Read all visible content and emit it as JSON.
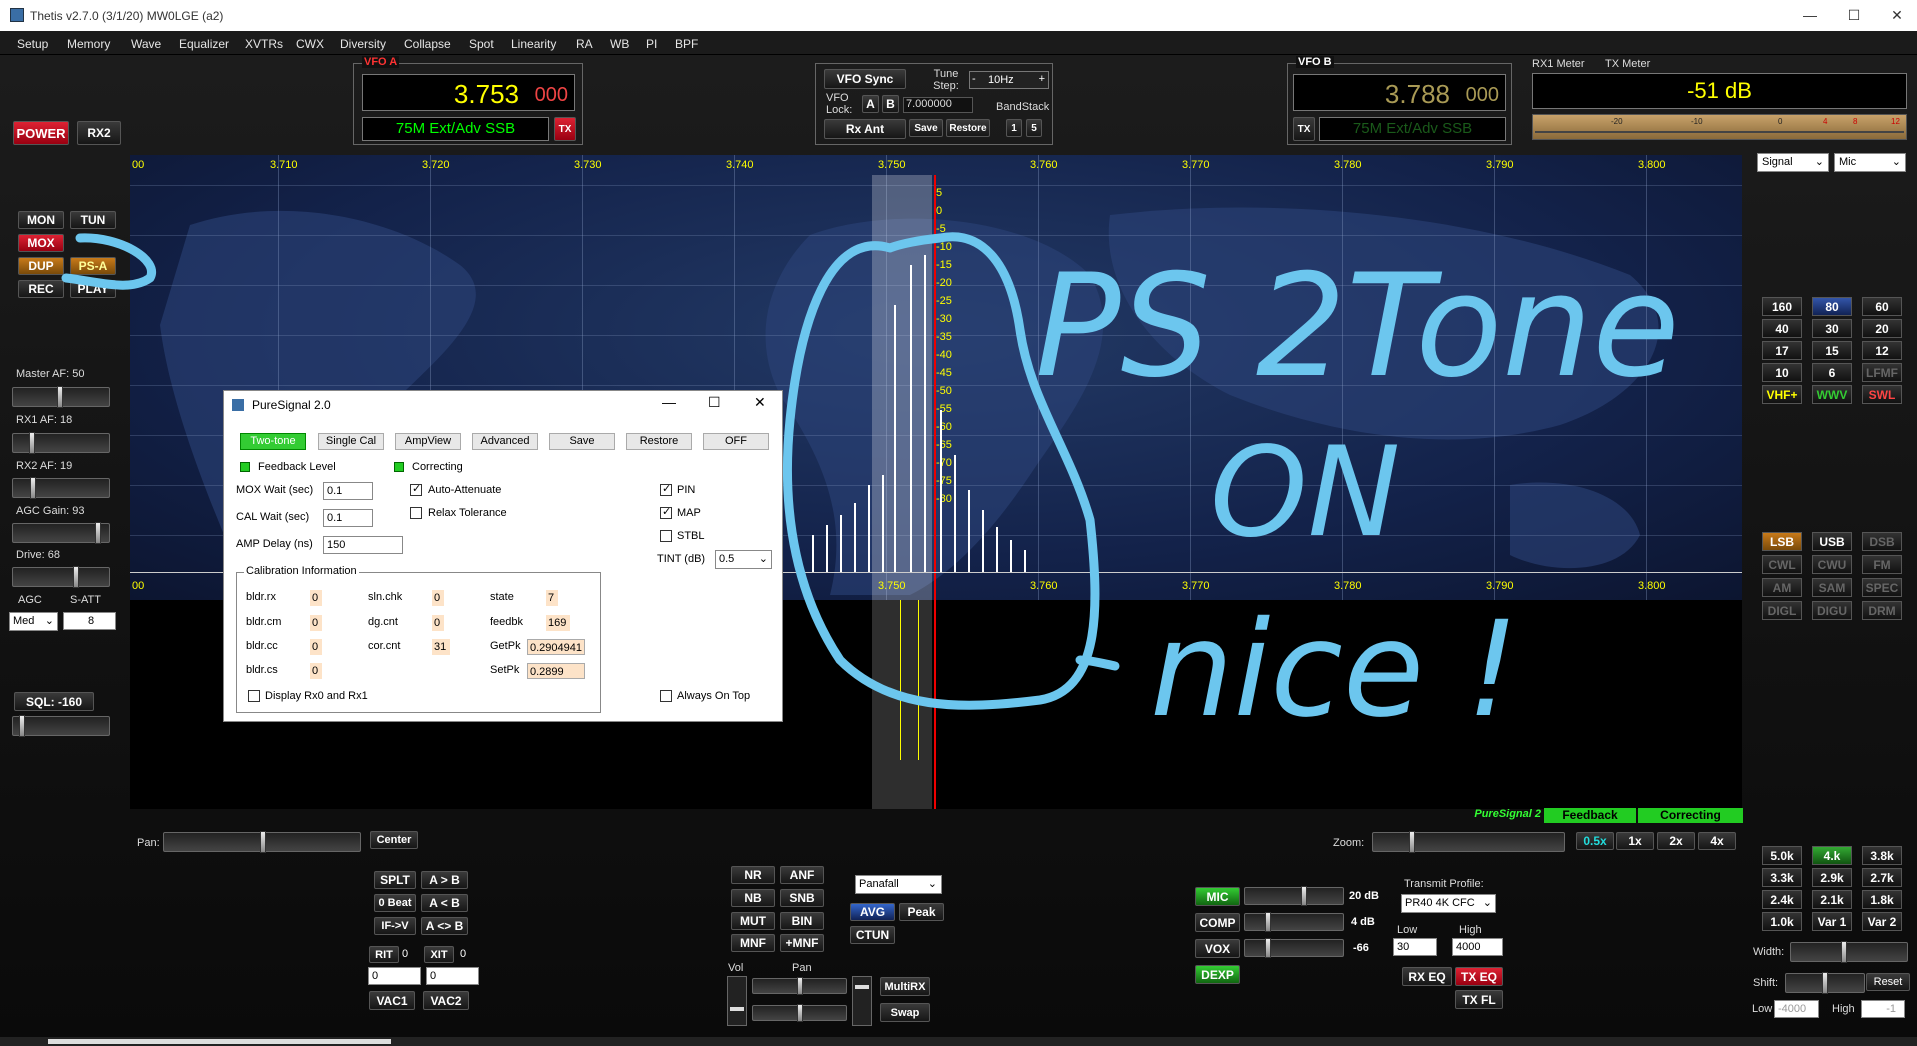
{
  "window": {
    "title": "Thetis v2.7.0 (3/1/20) MW0LGE (a2)",
    "min": "—",
    "max": "☐",
    "close": "✕"
  },
  "menu": [
    "Setup",
    "Memory",
    "Wave",
    "Equalizer",
    "XVTRs",
    "CWX",
    "Diversity",
    "Collapse",
    "Spot",
    "Linearity",
    "RA",
    "WB",
    "PI",
    "BPF"
  ],
  "left": {
    "power": "POWER",
    "rx2": "RX2",
    "mon": "MON",
    "tun": "TUN",
    "mox": "MOX",
    "dup": "DUP",
    "psa": "PS-A",
    "rec": "REC",
    "play": "PLAY",
    "master_af": "Master AF:  50",
    "rx1_af": "RX1 AF:  18",
    "rx2_af": "RX2 AF:  19",
    "agc_gain": "AGC Gain:  93",
    "drive": "Drive:  68",
    "agc": "AGC",
    "satt": "S-ATT",
    "agc_mode": "Med",
    "satt_val": "8",
    "sql": "SQL:  -160"
  },
  "levels": {
    "master_af": 0.5,
    "rx1_af": 0.18,
    "rx2_af": 0.19,
    "agc_gain": 0.93,
    "drive": 0.68
  },
  "vfoa": {
    "label": "VFO A",
    "freq": "3.753",
    "sub": "000",
    "mode": "75M Ext/Adv SSB",
    "tx": "TX"
  },
  "vfob": {
    "label": "VFO B",
    "freq": "3.788",
    "sub": "000",
    "mode": "75M Ext/Adv SSB",
    "tx": "TX"
  },
  "center": {
    "vfo_sync": "VFO Sync",
    "tune_step": "Tune Step:",
    "step_val": "10Hz",
    "vfo_lock": "VFO Lock:",
    "a": "A",
    "b": "B",
    "freq": "7.000000",
    "bandstack": "BandStack",
    "rx_ant": "Rx Ant",
    "save": "Save",
    "restore": "Restore",
    "b1": "1",
    "b5": "5"
  },
  "meter": {
    "rx1": "RX1 Meter",
    "tx": "TX Meter",
    "reading": "-51 dB",
    "scale": [
      "-20",
      "-10",
      "0",
      "4",
      "8",
      "12"
    ],
    "sel1": "Signal",
    "sel2": "Mic"
  },
  "panadapter": {
    "top_freqs": [
      "00",
      "3.710",
      "3.720",
      "3.730",
      "3.740",
      "3.750",
      "3.760",
      "3.770",
      "3.780",
      "3.790",
      "3.800"
    ],
    "bottom_freqs": [
      "00",
      "3.750",
      "3.760",
      "3.770",
      "3.780",
      "3.790",
      "3.800"
    ],
    "db": [
      "5",
      "0",
      "-5",
      "-10",
      "-15",
      "-20",
      "-25",
      "-30",
      "-35",
      "-40",
      "-45",
      "-50",
      "-55",
      "-60",
      "-65",
      "-70",
      "-75",
      "-80"
    ],
    "status_ps": "PureSignal 2",
    "status_fb": "Feedback",
    "status_corr": "Correcting"
  },
  "ps": {
    "title": "PureSignal 2.0",
    "two_tone": "Two-tone",
    "single_cal": "Single Cal",
    "ampview": "AmpView",
    "advanced": "Advanced",
    "save": "Save",
    "restore": "Restore",
    "off": "OFF",
    "feedback_level": "Feedback Level",
    "correcting": "Correcting",
    "mox_wait": "MOX Wait (sec)",
    "mox_wait_val": "0.1",
    "cal_wait": "CAL Wait (sec)",
    "cal_wait_val": "0.1",
    "amp_delay": "AMP Delay (ns)",
    "amp_delay_val": "150",
    "auto_att": "Auto-Attenuate",
    "relax": "Relax Tolerance",
    "pin": "PIN",
    "map": "MAP",
    "stbl": "STBL",
    "tint": "TINT (dB)",
    "tint_val": "0.5",
    "calinfo": "Calibration Information",
    "bldr_rx": "bldr.rx",
    "bldr_rx_v": "0",
    "bldr_cm": "bldr.cm",
    "bldr_cm_v": "0",
    "bldr_cc": "bldr.cc",
    "bldr_cc_v": "0",
    "bldr_cs": "bldr.cs",
    "bldr_cs_v": "0",
    "sln_chk": "sln.chk",
    "sln_chk_v": "0",
    "dg_cnt": "dg.cnt",
    "dg_cnt_v": "0",
    "cor_cnt": "cor.cnt",
    "cor_cnt_v": "31",
    "state": "state",
    "state_v": "7",
    "feedbk": "feedbk",
    "feedbk_v": "169",
    "getpk": "GetPk",
    "getpk_v": "0.2904941",
    "setpk": "SetPk",
    "setpk_v": "0.2899",
    "display_rx": "Display Rx0 and Rx1",
    "always_top": "Always On Top"
  },
  "bands": [
    "160",
    "80",
    "60",
    "40",
    "30",
    "20",
    "17",
    "15",
    "12",
    "10",
    "6",
    "LFMF",
    "VHF+",
    "WWV",
    "SWL"
  ],
  "modes": [
    "LSB",
    "USB",
    "DSB",
    "CWL",
    "CWU",
    "FM",
    "AM",
    "SAM",
    "SPEC",
    "DIGL",
    "DIGU",
    "DRM"
  ],
  "filters": [
    "5.0k",
    "4.k",
    "3.8k",
    "3.3k",
    "2.9k",
    "2.7k",
    "2.4k",
    "2.1k",
    "1.8k",
    "1.0k",
    "Var 1",
    "Var 2"
  ],
  "filter_ctrl": {
    "width": "Width:",
    "shift": "Shift:",
    "reset": "Reset",
    "low": "Low",
    "low_v": "-4000",
    "high": "High",
    "high_v": "-1"
  },
  "bottom": {
    "pan": "Pan:",
    "center": "Center",
    "zoom": "Zoom:",
    "z05": "0.5x",
    "z1": "1x",
    "z2": "2x",
    "z4": "4x",
    "splt": "SPLT",
    "atob": "A > B",
    "beat": "0 Beat",
    "acb": "A < B",
    "ifv": "IF->V",
    "aswap": "A <> B",
    "rit": "RIT",
    "rit_v": "0",
    "xit": "XIT",
    "xit_v": "0",
    "rit_spin": "0",
    "xit_spin": "0",
    "vac1": "VAC1",
    "vac2": "VAC2",
    "nr": "NR",
    "anf": "ANF",
    "nb": "NB",
    "snb": "SNB",
    "mut": "MUT",
    "bin": "BIN",
    "mnf": "MNF",
    "pmnf": "+MNF",
    "display": "Panafall",
    "avg": "AVG",
    "peak": "Peak",
    "ctun": "CTUN",
    "vol": "Vol",
    "panl": "Pan",
    "multirx": "MultiRX",
    "swap": "Swap",
    "mic": "MIC",
    "mic_db": "20 dB",
    "comp": "COMP",
    "comp_db": "4 dB",
    "vox": "VOX",
    "vox_db": "-66",
    "dexp": "DEXP",
    "tx_profile": "Transmit Profile:",
    "profile": "PR40 4K CFC",
    "low": "Low",
    "low_v": "30",
    "high": "High",
    "high_v": "4000",
    "rxeq": "RX EQ",
    "txeq": "TX EQ",
    "txfl": "TX FL"
  },
  "annotation": {
    "line1": "PS 2Tone",
    "line2": "ON",
    "line3": "nice !"
  }
}
